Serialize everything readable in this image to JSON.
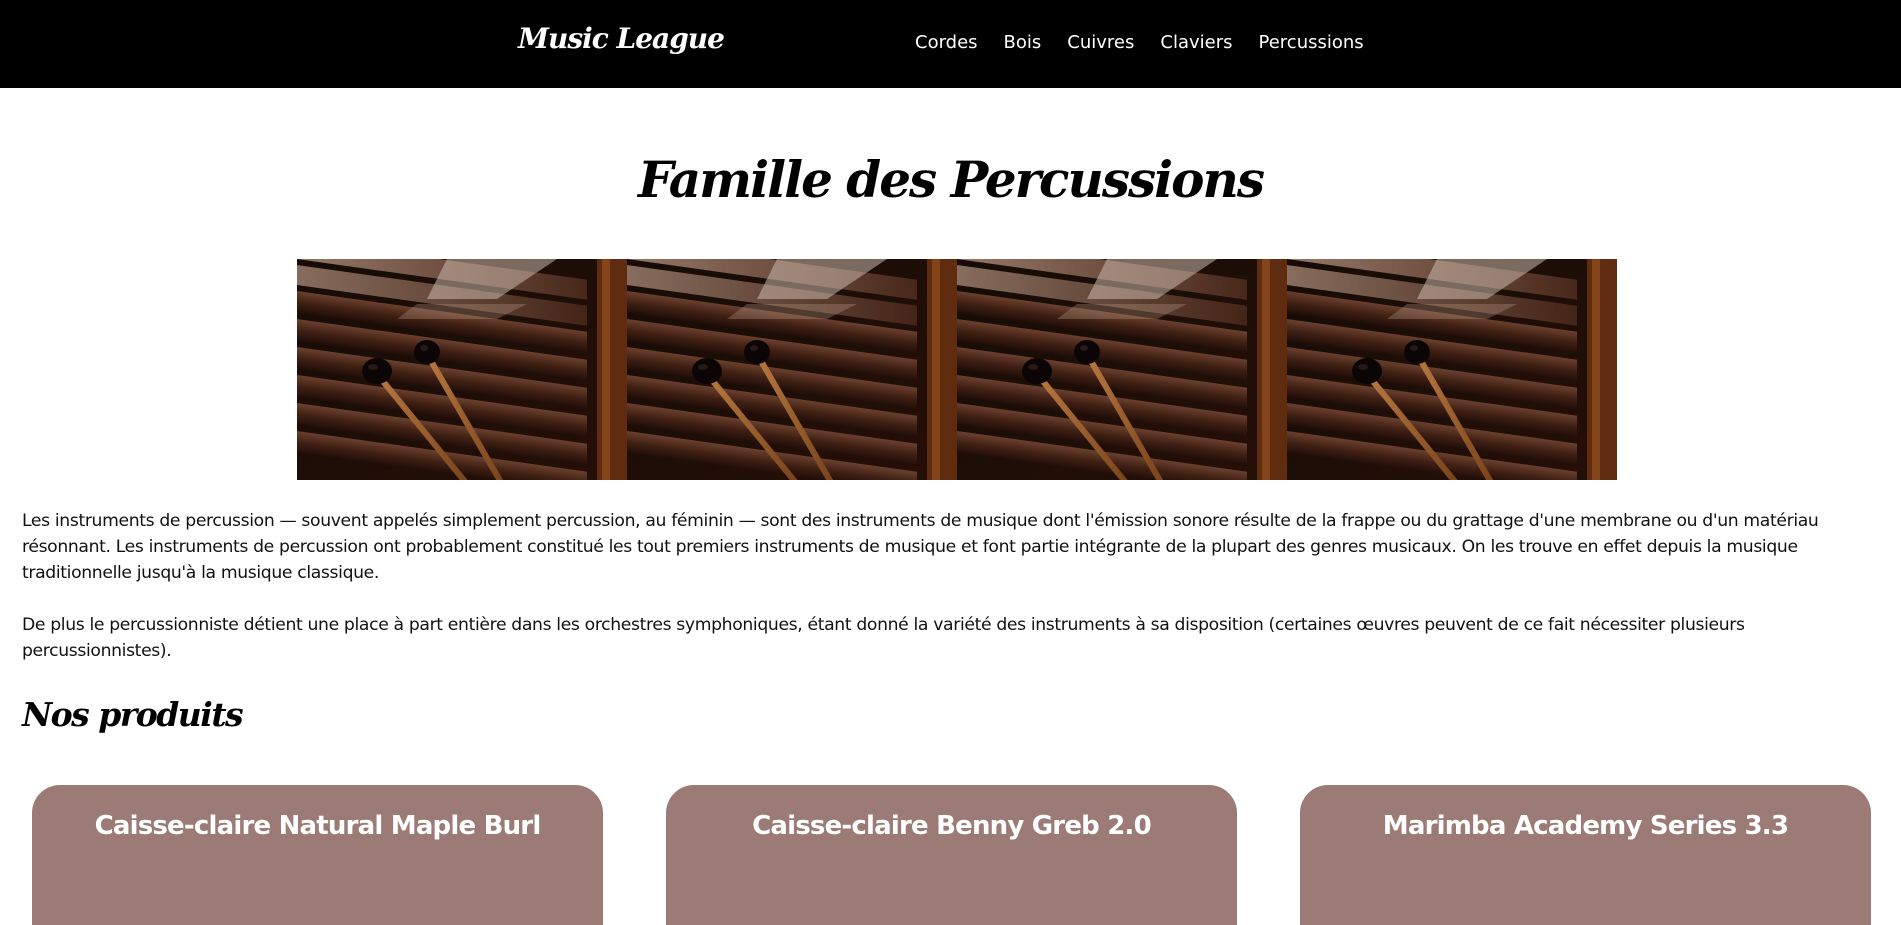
{
  "navbar": {
    "logo": "Music League",
    "links": [
      {
        "label": "Cordes"
      },
      {
        "label": "Bois"
      },
      {
        "label": "Cuivres"
      },
      {
        "label": "Claviers"
      },
      {
        "label": "Percussions"
      }
    ]
  },
  "main": {
    "title": "Famille des Percussions",
    "intro_paragraphs": [
      "Les instruments de percussion — souvent appelés simplement percussion, au féminin — sont des instruments de musique dont l'émission sonore résulte de la frappe ou du grattage d'une membrane ou d'un matériau résonnant. Les instruments de percussion ont probablement constitué les tout premiers instruments de musique et font partie intégrante de la plupart des genres musicaux. On les trouve en effet depuis la musique traditionnelle jusqu'à la musique classique.",
      "De plus le percussionniste détient une place à part entière dans les orchestres symphoniques, étant donné la variété des instruments à sa disposition (certaines œuvres peuvent de ce fait nécessiter plusieurs percussionnistes)."
    ],
    "products_title": "Nos produits",
    "products": [
      {
        "name": "Caisse-claire Natural Maple Burl"
      },
      {
        "name": "Caisse-claire Benny Greb 2.0"
      },
      {
        "name": "Marimba Academy Series 3.3"
      }
    ]
  },
  "colors": {
    "navbar_bg": "#000000",
    "card_bg": "#9c7b76",
    "text": "#111111"
  }
}
